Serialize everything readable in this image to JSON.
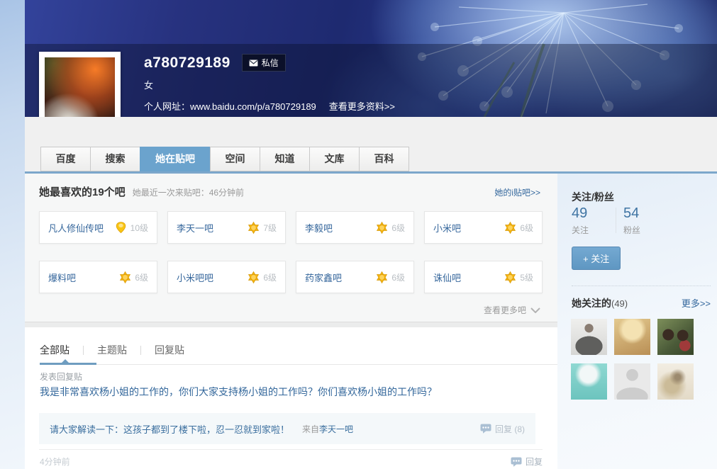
{
  "colors": {
    "link_blue": "#35689d",
    "active_tab_blue": "#6ba3cd",
    "follow_button_blue": "#649bc7",
    "star_gold": "#f7b510",
    "online_green": "#54b126"
  },
  "profile": {
    "username": "a780729189",
    "message_button_label": "私信",
    "gender": "女",
    "website": "个人网址：www.baidu.com/p/a780729189",
    "more_info_link": "查看更多资料>>"
  },
  "nav_tabs": [
    {
      "label": "百度",
      "active": false
    },
    {
      "label": "搜索",
      "active": false
    },
    {
      "label": "她在贴吧",
      "active": true
    },
    {
      "label": "空间",
      "active": false
    },
    {
      "label": "知道",
      "active": false
    },
    {
      "label": "文库",
      "active": false
    },
    {
      "label": "百科",
      "active": false
    }
  ],
  "favorites": {
    "title": "她最喜欢的19个吧",
    "subtitle": "她最近一次来贴吧：46分钟前",
    "itieba_link": "她的i贴吧>>",
    "more_link": "查看更多吧",
    "forums": [
      {
        "name": "凡人修仙传吧",
        "level": "10级",
        "icon": "level-badge-icon"
      },
      {
        "name": "李天一吧",
        "level": "7级",
        "icon": "level-star-icon"
      },
      {
        "name": "李毅吧",
        "level": "6级",
        "icon": "level-star-icon"
      },
      {
        "name": "小米吧",
        "level": "6级",
        "icon": "level-star-icon"
      },
      {
        "name": "爆料吧",
        "level": "6级",
        "icon": "level-star-icon"
      },
      {
        "name": "小米吧吧",
        "level": "6级",
        "icon": "level-star-icon"
      },
      {
        "name": "药家鑫吧",
        "level": "6级",
        "icon": "level-star-icon"
      },
      {
        "name": "诛仙吧",
        "level": "5级",
        "icon": "level-star-icon"
      }
    ]
  },
  "posts": {
    "tabs": [
      {
        "label": "全部贴",
        "active": true
      },
      {
        "label": "主题贴",
        "active": false
      },
      {
        "label": "回复贴",
        "active": false
      }
    ],
    "post": {
      "type_label": "发表回复贴",
      "content": "我是非常喜欢杨小姐的工作的，你们大家支持杨小姐的工作吗？你们喜欢杨小姐的工作吗？",
      "quote_text": "请大家解读一下：这孩子都到了楼下啦，忍一忍就到家啦！",
      "quote_from_label": "来自",
      "quote_from_forum": "李天一吧",
      "quote_reply_label": "回复 (8)",
      "time": "4分钟前",
      "reply_label": "回复"
    }
  },
  "sidebar": {
    "follow_stats": {
      "title": "关注/粉丝",
      "following_count": "49",
      "following_label": "关注",
      "followers_count": "54",
      "followers_label": "粉丝",
      "follow_button_label": "+ 关注"
    },
    "following": {
      "title": "她关注的",
      "count": "(49)",
      "more_link": "更多>>",
      "avatars": [
        "man-in-suit",
        "blonde-woman",
        "monchhichi-dolls",
        "anime-boy",
        "default-silhouette",
        "sketch-art"
      ]
    }
  }
}
